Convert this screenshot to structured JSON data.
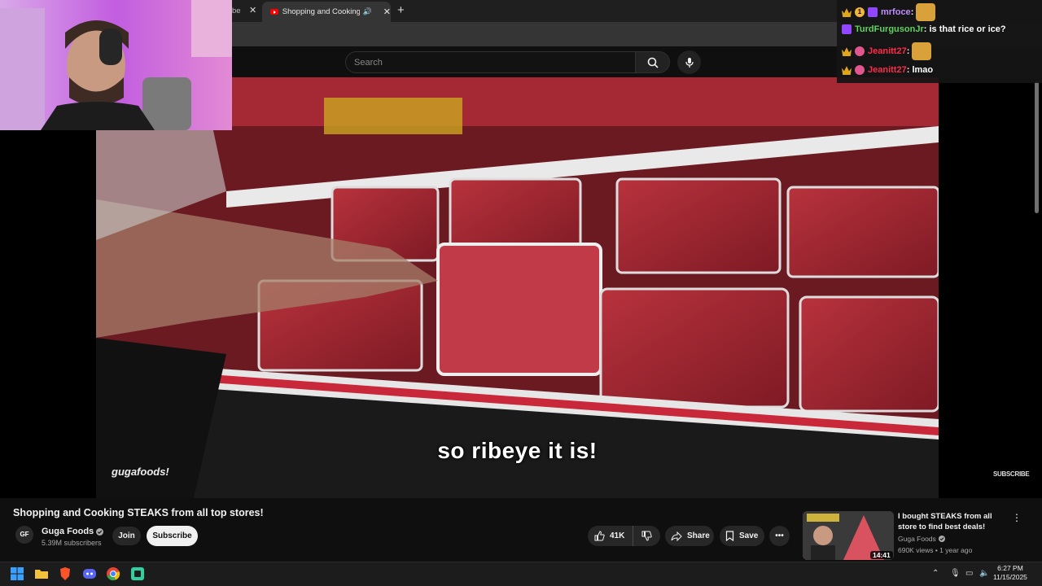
{
  "browser": {
    "prev_tab_fragment": "be",
    "active_tab_title": "Shopping and Cooking STE",
    "search_placeholder": "Search"
  },
  "chat": {
    "messages": [
      {
        "user": "mrfoce",
        "text": "",
        "color": "#c08cff"
      },
      {
        "user": "TurdFurgusonJr",
        "text": "is that rice or ice?",
        "color": "#5fd35f"
      },
      {
        "user": "Jeanitt27",
        "text": "",
        "color": "#ff2a4a"
      },
      {
        "user": "Jeanitt27",
        "text": "lmao",
        "color": "#ff2a4a"
      }
    ],
    "coin_badge": "1"
  },
  "video": {
    "caption": "so ribeye it is!",
    "watermark": "gugafoods!",
    "subscribe_watermark": "SUBSCRIBE",
    "title": "Shopping and Cooking STEAKS from all top stores!"
  },
  "channel": {
    "avatar_text": "GF",
    "name": "Guga Foods",
    "subscribers": "5.39M subscribers",
    "join_label": "Join",
    "subscribe_label": "Subscribe"
  },
  "actions": {
    "likes": "41K",
    "share_label": "Share",
    "save_label": "Save"
  },
  "recommendation": {
    "title": "I bought STEAKS from all store to find best deals!",
    "channel": "Guga Foods",
    "meta": "690K views • 1 year ago",
    "duration": "14:41"
  },
  "taskbar": {
    "time": "6:27 PM",
    "date": "11/15/2025"
  },
  "colors": {
    "accent": "#ff0000",
    "background": "#0f0f0f"
  }
}
